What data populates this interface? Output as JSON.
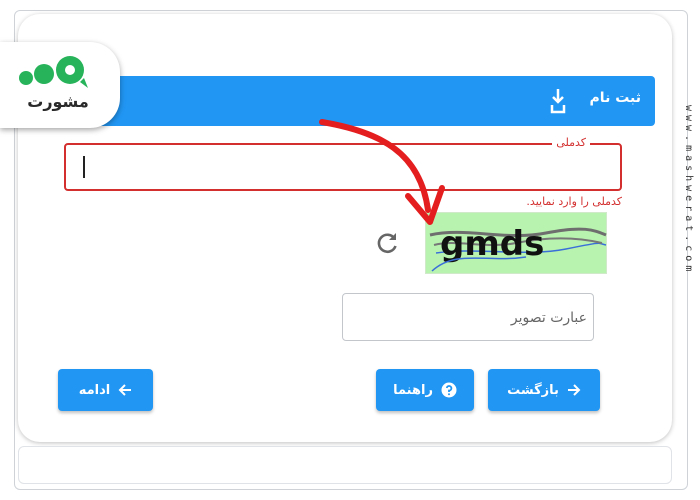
{
  "header": {
    "title": "ثبت نام"
  },
  "logo": {
    "text": "مشورت"
  },
  "watermark": {
    "text": "www.mashwerat.com"
  },
  "national_id": {
    "label": "کدملی",
    "value": "",
    "error": "کدملی را وارد نمایید."
  },
  "captcha": {
    "image_text": "gmds",
    "input_placeholder": "عبارت تصویر"
  },
  "buttons": {
    "back": "بازگشت",
    "help": "راهنما",
    "continue": "ادامه"
  },
  "colors": {
    "primary": "#2196f3",
    "error": "#d32f2f",
    "captcha_bg": "#b9f3b0",
    "annotation_arrow": "#e41e1e"
  },
  "icons": {
    "header": "document-download-icon",
    "refresh": "refresh-icon",
    "back": "arrow-right-icon",
    "help": "question-circle-icon",
    "continue": "arrow-left-icon"
  }
}
